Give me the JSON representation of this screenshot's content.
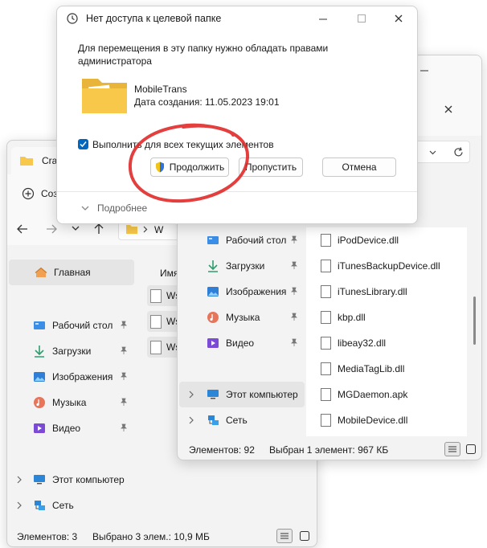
{
  "left_window": {
    "tab_title": "Crac",
    "toolbar_new": "Созд",
    "address": "W",
    "column_header": "Имя",
    "files": [
      "Ws",
      "Ws",
      "Ws"
    ],
    "nav": {
      "home": "Главная",
      "desktop": "Рабочий стол",
      "downloads": "Загрузки",
      "images": "Изображения",
      "music": "Музыка",
      "video": "Видео",
      "this_pc": "Этот компьютер",
      "network": "Сеть"
    },
    "status": {
      "count": "Элементов: 3",
      "selected": "Выбрано 3 элем.: 10,9 МБ"
    }
  },
  "right_window": {
    "nav": {
      "desktop": "Рабочий стол",
      "downloads": "Загрузки",
      "images": "Изображения",
      "music": "Музыка",
      "video": "Видео",
      "this_pc": "Этот компьютер",
      "network": "Сеть"
    },
    "files": [
      "iPodDevice.dll",
      "iTunesBackupDevice.dll",
      "iTunesLibrary.dll",
      "kbp.dll",
      "libeay32.dll",
      "MediaTagLib.dll",
      "MGDaemon.apk",
      "MobileDevice.dll"
    ],
    "status": {
      "count": "Элементов: 92",
      "selected": "Выбран 1 элемент: 967 КБ"
    }
  },
  "dialog": {
    "title": "Нет доступа к целевой папке",
    "message": "Для перемещения в эту папку нужно обладать правами администратора",
    "folder_name": "MobileTrans",
    "folder_date": "Дата создания: 11.05.2023 19:01",
    "checkbox_label": "Выполнить для всех текущих элементов",
    "checkbox_checked": true,
    "buttons": {
      "continue": "Продолжить",
      "skip": "Пропустить",
      "cancel": "Отмена"
    },
    "details": "Подробнее"
  },
  "colors": {
    "accent": "#0067c0",
    "annotation": "#e02a2a",
    "folder": "#f8c84a"
  }
}
